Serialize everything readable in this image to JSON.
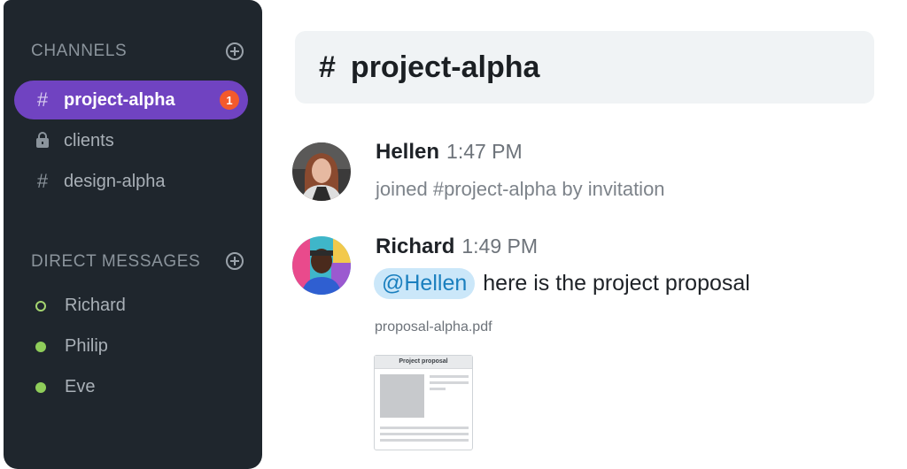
{
  "sidebar": {
    "channels_heading": "CHANNELS",
    "channels": [
      {
        "icon": "hash-icon",
        "label": "project-alpha",
        "active": true,
        "badge": "1"
      },
      {
        "icon": "lock-icon",
        "label": "clients",
        "active": false
      },
      {
        "icon": "hash-icon",
        "label": "design-alpha",
        "active": false
      }
    ],
    "dm_heading": "DIRECT MESSAGES",
    "direct_messages": [
      {
        "label": "Richard",
        "status": "away"
      },
      {
        "label": "Philip",
        "status": "online"
      },
      {
        "label": "Eve",
        "status": "online"
      }
    ]
  },
  "header": {
    "hash": "#",
    "title": "project-alpha"
  },
  "messages": [
    {
      "author": "Hellen",
      "time": "1:47 PM",
      "text": "joined #project-alpha by invitation"
    },
    {
      "author": "Richard",
      "time": "1:49 PM",
      "mention": "@Hellen",
      "text": "here is the project proposal",
      "attachment": {
        "filename": "proposal-alpha.pdf",
        "preview_title": "Project proposal"
      }
    }
  ],
  "colors": {
    "sidebar_bg": "#1f262d",
    "active_channel": "#7043c1",
    "badge": "#f35a2c",
    "mention_bg": "#cbe7f9",
    "online": "#8fcd5a"
  }
}
